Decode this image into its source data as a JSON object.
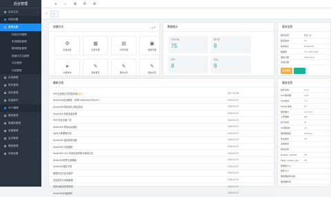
{
  "sidebar": {
    "title": "后台管理",
    "items": [
      {
        "label": "后台主页",
        "type": "top"
      },
      {
        "label": "网站设置",
        "type": "sec"
      },
      {
        "label": "管理设置",
        "type": "act"
      },
      {
        "label": "网站访问管理",
        "type": "sub"
      },
      {
        "label": "系统模板管理",
        "type": "sub"
      },
      {
        "label": "模块模板管理",
        "type": "sub"
      },
      {
        "label": "频道与栏位管理",
        "type": "sub"
      },
      {
        "label": "评论管理",
        "type": "sub"
      },
      {
        "label": "内容管理",
        "type": "sub"
      },
      {
        "label": "内容管理",
        "type": "top"
      },
      {
        "label": "附件管理",
        "type": "top"
      },
      {
        "label": "插件管理",
        "type": "top"
      },
      {
        "label": "批量维护",
        "type": "top"
      },
      {
        "label": "SEO管理",
        "type": "sec"
      },
      {
        "label": "模块管理",
        "type": "top"
      },
      {
        "label": "数据库管理",
        "type": "top"
      },
      {
        "label": "采集管理",
        "type": "top"
      },
      {
        "label": "会员管理",
        "type": "top"
      },
      {
        "label": "模板管理",
        "type": "top"
      },
      {
        "label": "系统设置",
        "type": "top"
      }
    ]
  },
  "topbar": {
    "icons": [
      "≡",
      "⌂",
      "⊞",
      "⟳",
      "⚙"
    ]
  },
  "tabs": {
    "left_arrow": "«",
    "home": "⌂"
  },
  "shortcuts": {
    "title": "快捷方式",
    "items": [
      {
        "icon": "⚙",
        "label": "系统设置"
      },
      {
        "icon": "▦",
        "label": "栏目管理"
      },
      {
        "icon": "▤",
        "label": "文件管理"
      },
      {
        "icon": "▣",
        "label": "模板管理"
      },
      {
        "icon": "➤",
        "label": "内容发布"
      },
      {
        "icon": "✎",
        "label": "更新首页"
      },
      {
        "icon": "✎",
        "label": "更新全局"
      },
      {
        "icon": "✎",
        "label": "更新栏目"
      }
    ]
  },
  "stats": {
    "title": "数据统计",
    "items": [
      {
        "label": "普通文章",
        "value": "75"
      },
      {
        "label": "图片集",
        "value": "8"
      },
      {
        "label": "软件",
        "value": "8"
      },
      {
        "label": "商品",
        "value": "9"
      }
    ]
  },
  "version": {
    "title": "版本信息",
    "rows": [
      {
        "k": "程序名称",
        "v": "桃花_玄"
      },
      {
        "k": "程序版本",
        "v": "V6"
      },
      {
        "k": "版本信息",
        "v": "DedeCMS"
      },
      {
        "k": "数据库",
        "v": "V6_UTF8_SP2"
      },
      {
        "k": "更新日期",
        "v": "2020-02-12"
      },
      {
        "k": "系统日期",
        "v": ""
      }
    ],
    "btn1": "检测更新",
    "btn2": ""
  },
  "news": {
    "title": "最新文档",
    "rows": [
      {
        "t": "PHP正则表达式匹配实例",
        "hot": "[高亮]",
        "d": "2017-03-06"
      },
      {
        "t": "DedeCMS实战教程：织梦CMS(DedeCMS)V5.7...",
        "hot": "",
        "d": "2016-03-07"
      },
      {
        "t": "DedeCMS中如何防止跨站攻击",
        "hot": "",
        "d": "2016-03-07"
      },
      {
        "t": "DedeCMS 系统安装步骤",
        "hot": "",
        "d": "2016-03-07"
      },
      {
        "t": "PHP 时区问题一览",
        "hot": "",
        "d": "2016-03-07"
      },
      {
        "t": "DedeCMS 修改后台路径",
        "hot": "",
        "d": "2016-03-07"
      },
      {
        "t": "MySQL数据库优化",
        "hot": "",
        "d": "2016-03-07"
      },
      {
        "t": "DedeCMS 建站常用功能",
        "hot": "",
        "d": "2016-03-07"
      },
      {
        "t": "DedeCMS 内容模型",
        "hot": "",
        "d": "2016-03-07"
      },
      {
        "t": "DedeCMS V6.0 系统信息获取与使用方法",
        "hot": "",
        "d": "2016-03-07"
      },
      {
        "t": "DedeCMS织梦主题模版",
        "hot": "",
        "d": "2016-03-07"
      },
      {
        "t": "DedeCMS插件开发",
        "hot": "",
        "d": "2016-03-07"
      },
      {
        "t": "数据安全与站点维护",
        "hot": "",
        "d": "2016-03-07"
      },
      {
        "t": "内容发布与流程管理",
        "hot": "",
        "d": "2016-03-07"
      },
      {
        "t": "常用功能及标签说明",
        "hot": "",
        "d": "2016-03-07"
      },
      {
        "t": "DedeCMS升级说明",
        "hot": "",
        "d": "2016-03-07"
      }
    ]
  },
  "sysinfo": {
    "title": "服务信息",
    "rows": [
      {
        "k": "操作系统",
        "v": "Linux"
      },
      {
        "k": "Web服务器",
        "v": "nginx"
      },
      {
        "k": "PHP版本",
        "v": "7.3"
      },
      {
        "k": "MySQL版本",
        "v": "5.7"
      },
      {
        "k": "服务器IP",
        "v": "127.0.0.1"
      },
      {
        "k": "上传限制",
        "v": "8M"
      },
      {
        "k": "执行时间",
        "v": "30"
      },
      {
        "k": "GD库版本",
        "v": "2.1"
      },
      {
        "k": "服务器域名",
        "v": "localhost"
      },
      {
        "k": "安全模式",
        "v": "Off"
      },
      {
        "k": "系统时间",
        "v": ""
      },
      {
        "k": "附件目录",
        "v": ""
      },
      {
        "k": "Register_Globals",
        "v": "Off"
      },
      {
        "k": "Magic_Quotes_Gpc",
        "v": "Off"
      },
      {
        "k": "数据库大小",
        "v": ""
      },
      {
        "k": "缓存大小",
        "v": ""
      },
      {
        "k": "服务器操作系统",
        "v": ""
      },
      {
        "k": "服务器时间",
        "v": ""
      }
    ]
  },
  "colors": {
    "accent": "#1f8ef1",
    "sidebar": "#2b3541",
    "value": "#1ab394",
    "btn1": "#f0ad4e",
    "btn2": "#1ab394"
  }
}
